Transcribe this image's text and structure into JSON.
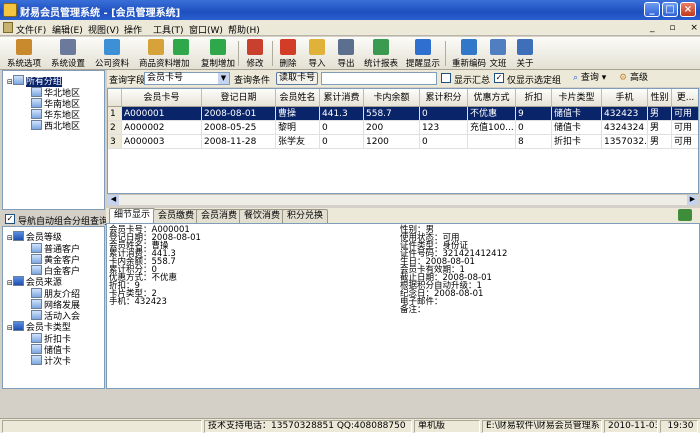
{
  "window": {
    "title": "财易会员管理系统 - [会员管理系统]",
    "min": "_",
    "max": "□",
    "close": "×",
    "restore_inner": "_ ▫ ×"
  },
  "menu": [
    "文件(F)",
    "编辑(E)",
    "视图(V)",
    "操作",
    "工具(T)",
    "窗口(W)",
    "帮助(H)"
  ],
  "toolbar": [
    {
      "label": "系统选项",
      "icon": "wrench-icon",
      "color": "#c98a2e"
    },
    {
      "label": "系统设置",
      "icon": "tools-icon",
      "color": "#6b7a9c"
    },
    {
      "label": "公司资料",
      "icon": "company-icon",
      "color": "#3d8fd6"
    },
    {
      "label": "商品资料",
      "icon": "goods-icon",
      "color": "#d8a23a"
    },
    {
      "label": "增加",
      "icon": "add-icon",
      "color": "#2ea84a"
    },
    {
      "label": "复制增加",
      "icon": "copy-add-icon",
      "color": "#2ea84a"
    },
    {
      "label": "修改",
      "icon": "edit-icon",
      "color": "#c9402e"
    },
    {
      "label": "删除",
      "icon": "delete-icon",
      "color": "#d23b26"
    },
    {
      "label": "导入",
      "icon": "import-icon",
      "color": "#e0b23a"
    },
    {
      "label": "导出",
      "icon": "export-icon",
      "color": "#5c6f8f"
    },
    {
      "label": "统计报表",
      "icon": "report-icon",
      "color": "#3a9a4f"
    },
    {
      "label": "提醒显示",
      "icon": "reminder-icon",
      "color": "#2f6fd0"
    },
    {
      "label": "重新编码",
      "icon": "recode-icon",
      "color": "#3178c8"
    },
    {
      "label": "文班",
      "icon": "user-icon",
      "color": "#4f7fc0"
    },
    {
      "label": "关于",
      "icon": "help-icon",
      "color": "#3f6fb8"
    }
  ],
  "tree_top": {
    "root": "所有分组",
    "children": [
      "华北地区",
      "华南地区",
      "华东地区",
      "西北地区"
    ]
  },
  "auto_group_label": "导航自动组合分组查询",
  "tree_bottom": [
    {
      "label": "会员等级",
      "children": [
        "普通客户",
        "黄金客户",
        "白金客户"
      ]
    },
    {
      "label": "会员来源",
      "children": [
        "朋友介绍",
        "网络发展",
        "活动入会"
      ]
    },
    {
      "label": "会员卡类型",
      "children": [
        "折扣卡",
        "储值卡",
        "计次卡"
      ]
    }
  ],
  "search": {
    "field_label": "查询字段",
    "field_value": "会员卡号",
    "condition_label": "查询条件",
    "read_card": "读取卡号",
    "show_summary": "显示汇总",
    "show_only_selected": "仅显示选定组",
    "query": "查询",
    "advanced": "高级"
  },
  "grid": {
    "columns": [
      "会员卡号",
      "登记日期",
      "会员姓名",
      "累计消费",
      "卡内余额",
      "累计积分",
      "优惠方式",
      "折扣",
      "卡片类型",
      "手机",
      "性别",
      "更..."
    ],
    "rows": [
      {
        "no": "1",
        "cells": [
          "A000001",
          "2008-08-01",
          "曹操",
          "441.3",
          "558.7",
          "0",
          "不优惠",
          "9",
          "储值卡",
          "432423",
          "男",
          "可用"
        ]
      },
      {
        "no": "2",
        "cells": [
          "A000002",
          "2008-05-25",
          "黎明",
          "0",
          "200",
          "123",
          "充值100...",
          "0",
          "储值卡",
          "4324324",
          "男",
          "可用"
        ]
      },
      {
        "no": "3",
        "cells": [
          "A000003",
          "2008-11-28",
          "张学友",
          "0",
          "1200",
          "0",
          "",
          "8",
          "折扣卡",
          "1357032...",
          "男",
          "可用"
        ]
      }
    ]
  },
  "tabs": [
    "细节显示",
    "会员缴费",
    "会员消费",
    "餐饮消费",
    "积分兑换"
  ],
  "detail_left": [
    "会员卡号：A000001",
    "登记日期：2008-08-01",
    "会员姓名：曹操",
    "累计消费：441.3",
    "卡内余额：558.7",
    "累计积分：0",
    "优惠方式：不优惠",
    "折扣：9",
    "卡片类型：2",
    "手机：432423"
  ],
  "detail_right": [
    "性别：男",
    "使用状态：可用",
    "证件类型：身份证",
    "证件号码：321421412412",
    "生日：2008-08-01",
    "会员卡有效期：1",
    "截止日期：2008-08-01",
    "根据积分自动升级：1",
    "纪念日：2008-08-01",
    "电子邮件：",
    "备注："
  ],
  "status": {
    "support": "技术支持电话：13570328851 QQ:408088750",
    "edition": "单机版",
    "path": "E:\\财易软件\\财易会员管理系",
    "date": "2010-11-03",
    "time": "19:30"
  }
}
